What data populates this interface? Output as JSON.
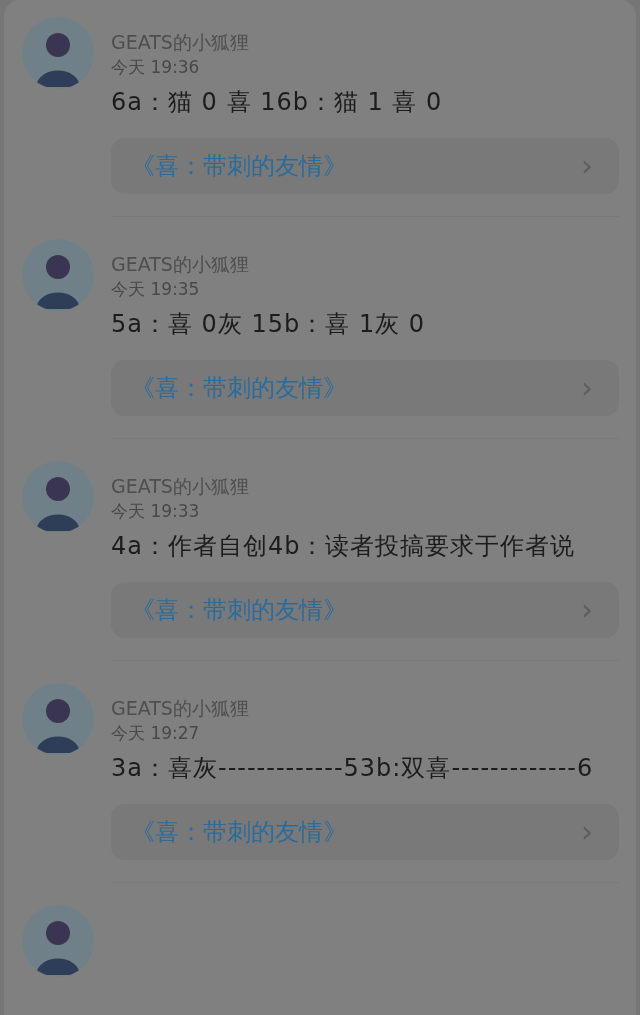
{
  "posts": [
    {
      "kind": "full",
      "author": "GEATS的小狐狸",
      "time": "今天 19:36",
      "text": "6a：猫 0 喜 16b：猫 1 喜 0",
      "link": "《喜：带刺的友情》",
      "chevron": "›"
    },
    {
      "kind": "full",
      "author": "GEATS的小狐狸",
      "time": "今天 19:35",
      "text": "5a：喜 0灰 15b：喜 1灰 0",
      "link": "《喜：带刺的友情》",
      "chevron": "›"
    },
    {
      "kind": "full",
      "author": "GEATS的小狐狸",
      "time": "今天 19:33",
      "text": "4a：作者自创4b：读者投搞要求于作者说",
      "link": "《喜：带刺的友情》",
      "chevron": "›"
    },
    {
      "kind": "full",
      "author": "GEATS的小狐狸",
      "time": "今天 19:27",
      "text": "3a：喜灰-------------53b:双喜-------------6",
      "link": "《喜：带刺的友情》",
      "chevron": "›"
    },
    {
      "kind": "cut"
    }
  ]
}
